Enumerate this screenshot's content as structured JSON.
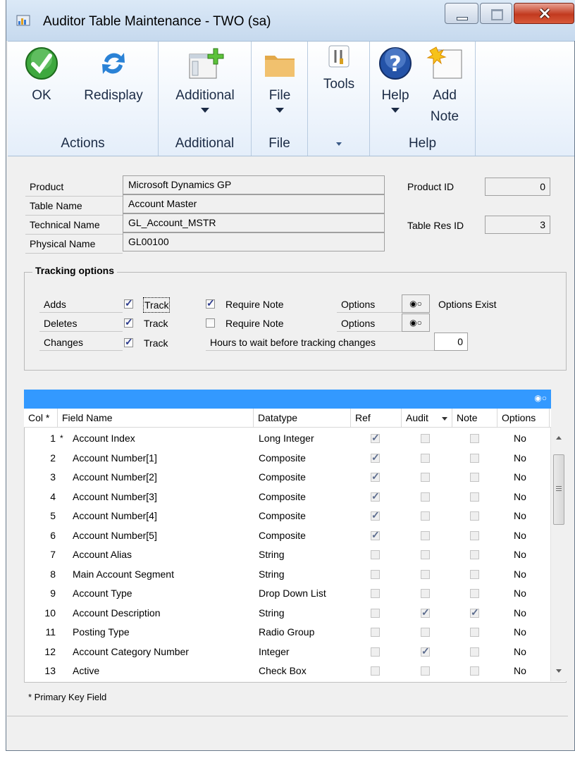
{
  "window": {
    "title": "Auditor Table Maintenance  -  TWO (sa)"
  },
  "ribbon": {
    "ok_label": "OK",
    "redisplay_label": "Redisplay",
    "actions_group": "Actions",
    "additional_label": "Additional",
    "additional_group": "Additional",
    "file_label": "File",
    "file_group": "File",
    "tools_label": "Tools",
    "help_label": "Help",
    "add_note_line1": "Add",
    "add_note_line2": "Note",
    "help_group": "Help",
    "icons": [
      "ok-check-icon",
      "redisplay-arrows-icon",
      "additional-window-plus-icon",
      "file-folder-icon",
      "tools-icon",
      "help-question-icon",
      "add-note-icon"
    ]
  },
  "header": {
    "product_label": "Product",
    "product_value": "Microsoft Dynamics GP",
    "table_name_label": "Table Name",
    "table_name_value": "Account Master",
    "technical_name_label": "Technical Name",
    "technical_name_value": "GL_Account_MSTR",
    "physical_name_label": "Physical Name",
    "physical_name_value": "GL00100",
    "product_id_label": "Product ID",
    "product_id_value": "0",
    "table_res_id_label": "Table Res ID",
    "table_res_id_value": "3"
  },
  "tracking": {
    "title": "Tracking options",
    "adds_label": "Adds",
    "deletes_label": "Deletes",
    "changes_label": "Changes",
    "track_label": "Track",
    "require_note_label": "Require Note",
    "options_label": "Options",
    "options_exist_label": "Options Exist",
    "hours_label": "Hours to wait before tracking changes",
    "hours_value": "0",
    "adds_track": true,
    "deletes_track": true,
    "changes_track": true,
    "adds_require_note": true,
    "deletes_require_note": false
  },
  "grid": {
    "columns": [
      "Col *",
      "Field Name",
      "Datatype",
      "Ref",
      "Audit",
      "Note",
      "Options"
    ],
    "rows": [
      {
        "col": "1",
        "pk": "*",
        "field": "Account Index",
        "type": "Long Integer",
        "ref": true,
        "audit": false,
        "note": false,
        "options": "No"
      },
      {
        "col": "2",
        "pk": "",
        "field": "Account Number[1]",
        "type": "Composite",
        "ref": true,
        "audit": false,
        "note": false,
        "options": "No"
      },
      {
        "col": "3",
        "pk": "",
        "field": "Account Number[2]",
        "type": "Composite",
        "ref": true,
        "audit": false,
        "note": false,
        "options": "No"
      },
      {
        "col": "4",
        "pk": "",
        "field": "Account Number[3]",
        "type": "Composite",
        "ref": true,
        "audit": false,
        "note": false,
        "options": "No"
      },
      {
        "col": "5",
        "pk": "",
        "field": "Account Number[4]",
        "type": "Composite",
        "ref": true,
        "audit": false,
        "note": false,
        "options": "No"
      },
      {
        "col": "6",
        "pk": "",
        "field": "Account Number[5]",
        "type": "Composite",
        "ref": true,
        "audit": false,
        "note": false,
        "options": "No"
      },
      {
        "col": "7",
        "pk": "",
        "field": "Account Alias",
        "type": "String",
        "ref": false,
        "audit": false,
        "note": false,
        "options": "No"
      },
      {
        "col": "8",
        "pk": "",
        "field": "Main Account Segment",
        "type": "String",
        "ref": false,
        "audit": false,
        "note": false,
        "options": "No"
      },
      {
        "col": "9",
        "pk": "",
        "field": "Account Type",
        "type": "Drop Down List",
        "ref": false,
        "audit": false,
        "note": false,
        "options": "No"
      },
      {
        "col": "10",
        "pk": "",
        "field": "Account Description",
        "type": "String",
        "ref": false,
        "audit": true,
        "note": true,
        "options": "No"
      },
      {
        "col": "11",
        "pk": "",
        "field": "Posting Type",
        "type": "Radio Group",
        "ref": false,
        "audit": false,
        "note": false,
        "options": "No"
      },
      {
        "col": "12",
        "pk": "",
        "field": "Account Category Number",
        "type": "Integer",
        "ref": false,
        "audit": true,
        "note": false,
        "options": "No"
      },
      {
        "col": "13",
        "pk": "",
        "field": "Active",
        "type": "Check Box",
        "ref": false,
        "audit": false,
        "note": false,
        "options": "No"
      }
    ]
  },
  "footnote": "* Primary Key Field"
}
